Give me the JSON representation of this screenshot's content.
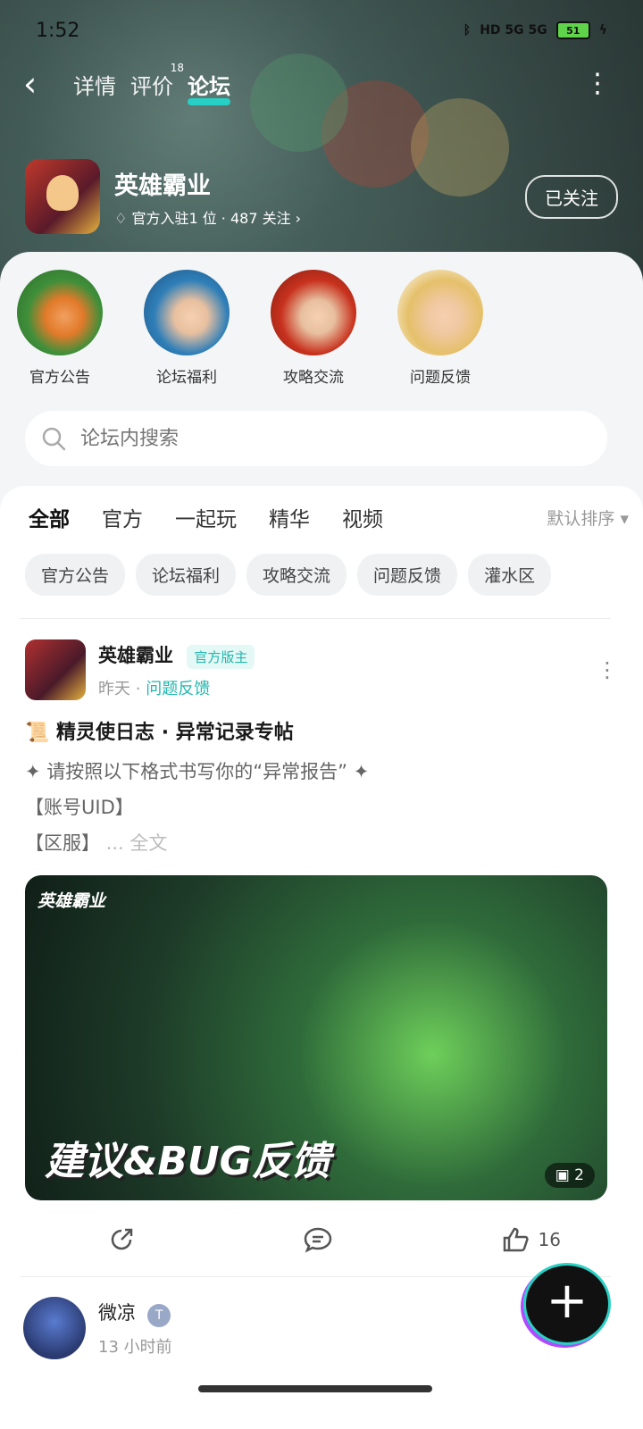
{
  "status_bar": {
    "time": "1:52",
    "signal": "HD 5G 5G",
    "battery": "51"
  },
  "nav": {
    "tabs": [
      {
        "label": "详情",
        "active": false
      },
      {
        "label": "评价",
        "badge": "18",
        "active": false
      },
      {
        "label": "论坛",
        "active": true
      }
    ]
  },
  "game": {
    "name": "英雄霸业",
    "stats": "官方入驻1 位 · 487 关注 ›",
    "follow_label": "已关注"
  },
  "categories": [
    {
      "label": "官方公告",
      "color": "#3f8f3a"
    },
    {
      "label": "论坛福利",
      "color": "#2f7fb8"
    },
    {
      "label": "攻略交流",
      "color": "#c8321e"
    },
    {
      "label": "问题反馈",
      "color": "#e5c06a"
    }
  ],
  "search": {
    "placeholder": "论坛内搜索"
  },
  "filter_tabs": [
    "全部",
    "官方",
    "一起玩",
    "精华",
    "视频"
  ],
  "sort_label": "默认排序 ▾",
  "chips": [
    "官方公告",
    "论坛福利",
    "攻略交流",
    "问题反馈",
    "灌水区"
  ],
  "post": {
    "author": "英雄霸业",
    "tag": "官方版主",
    "time": "昨天",
    "dot": "·",
    "section": "问题反馈",
    "title": "📜 精灵使日志 · 异常记录专帖",
    "lines": [
      "✦ 请按照以下格式书写你的“异常报告” ✦",
      "【账号UID】",
      "【区服】"
    ],
    "more": "... 全文",
    "image": {
      "logo": "英雄霸业",
      "banner": "建议&BUG反馈",
      "count": "2"
    },
    "likes": "16"
  },
  "post2": {
    "author": "微凉",
    "level": "T",
    "time": "13 小时前"
  },
  "accent": "#26d0c4"
}
